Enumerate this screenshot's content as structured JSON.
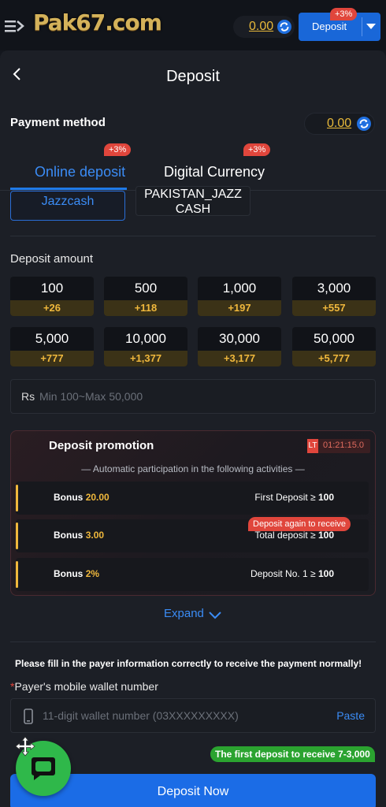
{
  "header": {
    "logo_text": "Pak67.com",
    "balance": "0.00",
    "deposit_label": "Deposit",
    "deposit_badge": "+3%"
  },
  "page": {
    "title": "Deposit"
  },
  "payment_method": {
    "label": "Payment method",
    "balance": "0.00",
    "tabs": [
      {
        "label": "Online deposit",
        "badge": "+3%",
        "active": true
      },
      {
        "label": "Digital Currency",
        "badge": "+3%",
        "active": false
      }
    ],
    "methods": [
      {
        "label": "Jazzcash",
        "selected": true
      },
      {
        "label": "PAKISTAN_JAZZ CASH",
        "selected": false
      }
    ]
  },
  "deposit_amount": {
    "label": "Deposit amount",
    "options": [
      {
        "value": "100",
        "bonus": "+26"
      },
      {
        "value": "500",
        "bonus": "+118"
      },
      {
        "value": "1,000",
        "bonus": "+197"
      },
      {
        "value": "3,000",
        "bonus": "+557"
      },
      {
        "value": "5,000",
        "bonus": "+777"
      },
      {
        "value": "10,000",
        "bonus": "+1,377"
      },
      {
        "value": "30,000",
        "bonus": "+3,177"
      },
      {
        "value": "50,000",
        "bonus": "+5,777"
      }
    ],
    "currency": "Rs",
    "placeholder": "Min 100~Max 50,000"
  },
  "promotion": {
    "title": "Deposit promotion",
    "timer_tag": "LT",
    "timer": "01:21:15.0",
    "subtitle": "Automatic participation in the following activities",
    "rows": [
      {
        "bonus_label": "Bonus",
        "bonus_value": "20.00",
        "condition": "First Deposit ≥",
        "threshold": "100"
      },
      {
        "bonus_label": "Bonus",
        "bonus_value": "3.00",
        "condition": "Total deposit ≥",
        "threshold": "100"
      },
      {
        "bonus_label": "Bonus",
        "bonus_value": "2%",
        "condition": "Deposit No. 1 ≥",
        "threshold": "100"
      }
    ],
    "again_badge": "Deposit again to receive",
    "expand_label": "Expand"
  },
  "payer": {
    "notice": "Please fill in the payer information correctly to receive the payment normally!",
    "required_mark": "*",
    "label": "Payer's mobile wallet number",
    "placeholder": "11-digit wallet number (03XXXXXXXXX)",
    "paste_label": "Paste"
  },
  "first_deposit_badge": "The first deposit to receive 7-3,000",
  "submit_label": "Deposit Now",
  "colors": {
    "accent": "#1b6ce6",
    "gold": "#f0b83c",
    "badge_red": "#e0463c",
    "badge_green": "#2ba330",
    "chat_green": "#2fb84a"
  }
}
